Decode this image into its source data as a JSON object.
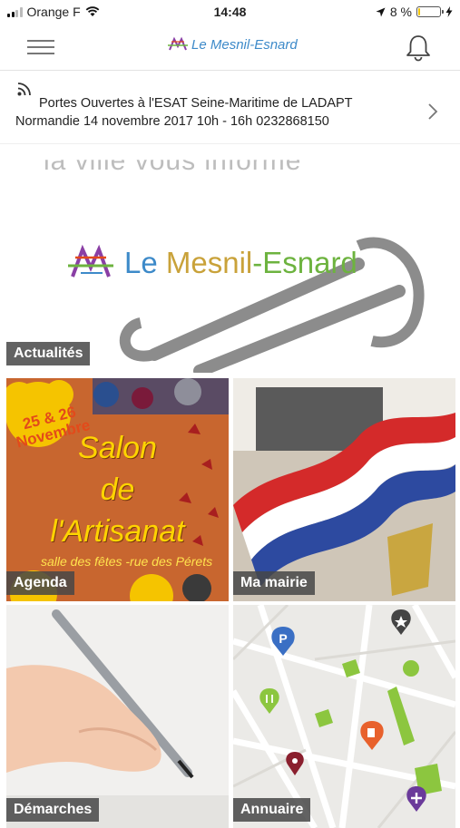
{
  "status_bar": {
    "carrier": "Orange F",
    "time": "14:48",
    "battery_percent": "8 %",
    "battery_level": 0.08
  },
  "navbar": {
    "logo_text": "Le Mesnil-Esnard"
  },
  "ticker": {
    "line1": "Portes Ouvertes à l'ESAT Seine-Maritime de LADAPT",
    "line2": "Normandie 14 novembre 2017 10h - 16h 0232868150"
  },
  "hero": {
    "watermark": "la ville vous informe",
    "logo_text_a": "Le ",
    "logo_text_b": "Mesnil",
    "logo_text_c": "-Esnard",
    "label": "Actualités"
  },
  "tiles": {
    "agenda": {
      "label": "Agenda",
      "poster_dates": "25 & 26\nNovembre",
      "poster_line1": "Salon",
      "poster_line2": "de",
      "poster_line3": "l'Artisanat",
      "poster_sub": "salle des fêtes -rue des Pérets"
    },
    "mairie": {
      "label": "Ma mairie"
    },
    "demarches": {
      "label": "Démarches"
    },
    "annuaire": {
      "label": "Annuaire",
      "pin_parking": "P"
    }
  },
  "colors": {
    "accent_blue": "#3d8ac9",
    "label_bg": "#464646",
    "poster_bg": "#c8662f",
    "poster_text": "#ffd400"
  }
}
